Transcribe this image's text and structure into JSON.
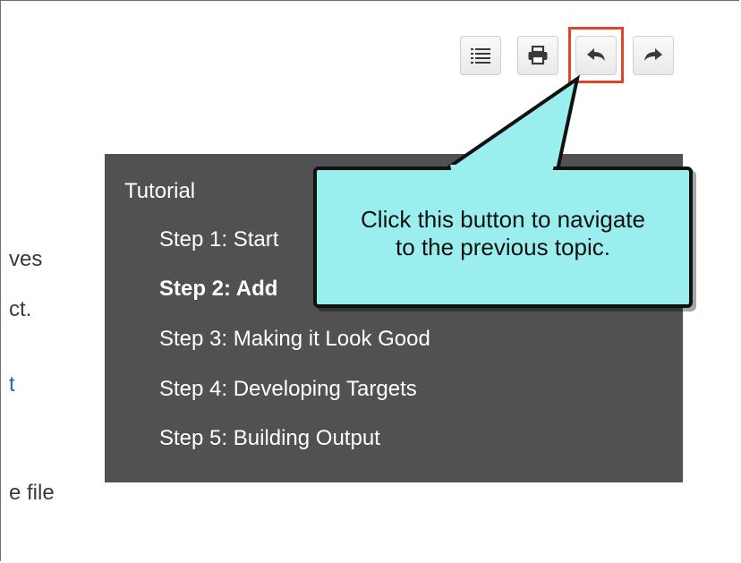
{
  "toolbar": {
    "buttons": [
      {
        "name": "toc-button",
        "icon": "list-icon"
      },
      {
        "name": "print-button",
        "icon": "printer-icon"
      },
      {
        "name": "previous-topic-button",
        "icon": "arrow-left-icon"
      },
      {
        "name": "next-topic-button",
        "icon": "arrow-right-icon"
      }
    ],
    "highlight_color": "#e0452a"
  },
  "background_text": {
    "line1": "ves",
    "line2": "ct.",
    "line3": "t",
    "line4": "e file"
  },
  "toc": {
    "title": "Tutorial",
    "items": [
      {
        "label": "Step 1: Start",
        "active": false
      },
      {
        "label": "Step 2: Add",
        "active": true
      },
      {
        "label": "Step 3: Making it Look Good",
        "active": false
      },
      {
        "label": "Step 4: Developing Targets",
        "active": false
      },
      {
        "label": "Step 5: Building Output",
        "active": false
      }
    ],
    "background": "#515151"
  },
  "callout": {
    "text": "Click this button to navigate\nto the previous topic.",
    "color": "#9beeee"
  }
}
